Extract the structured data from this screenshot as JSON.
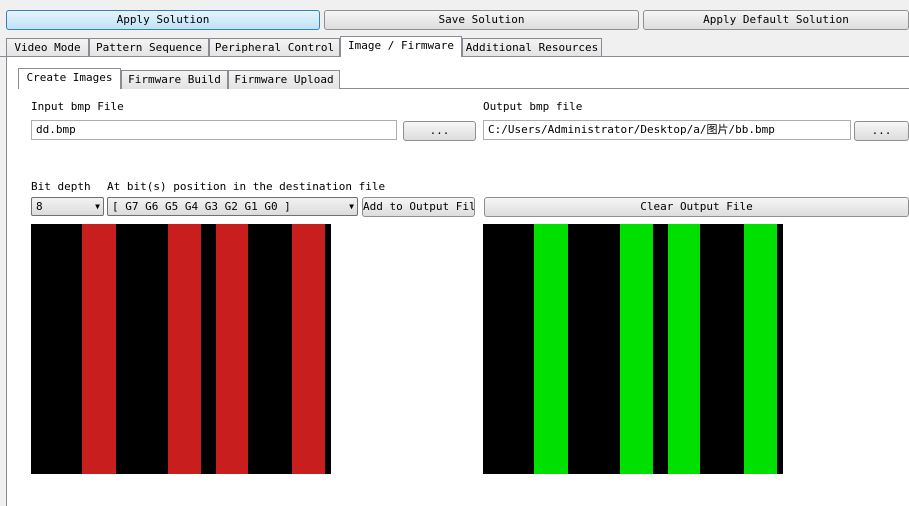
{
  "toolbar": {
    "apply_solution": "Apply Solution",
    "save_solution": "Save Solution",
    "apply_default": "Apply Default Solution"
  },
  "main_tabs": [
    "Video Mode",
    "Pattern Sequence",
    "Peripheral Control",
    "Image / Firmware",
    "Additional Resources"
  ],
  "sub_tabs": [
    "Create Images",
    "Firmware Build",
    "Firmware Upload"
  ],
  "input": {
    "label": "Input bmp File",
    "value": "dd.bmp",
    "browse_label": "..."
  },
  "output": {
    "label": "Output bmp file",
    "value": "C:/Users/Administrator/Desktop/a/图片/bb.bmp",
    "browse_label": "..."
  },
  "bit_depth": {
    "label": "Bit depth",
    "value": "8"
  },
  "bit_position": {
    "label": "At bit(s) position in the destination file",
    "value": "[ G7 G6 G5 G4 G3 G2 G1 G0 ]"
  },
  "actions": {
    "add_to_output": "Add to Output File",
    "clear_output": "Clear Output File"
  },
  "previews": {
    "input_color": "#c81e1e",
    "output_color": "#00e000"
  }
}
